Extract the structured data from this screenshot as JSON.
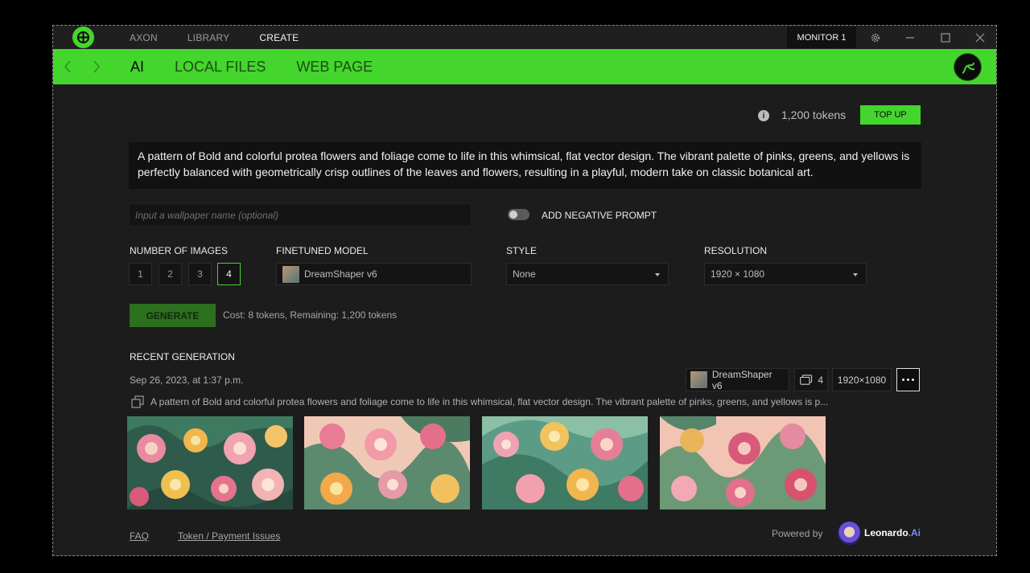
{
  "topnav": {
    "items": [
      "AXON",
      "LIBRARY",
      "CREATE"
    ],
    "active_index": 2
  },
  "titlebar": {
    "monitor_label": "MONITOR 1"
  },
  "subtabs": {
    "items": [
      "AI",
      "LOCAL FILES",
      "WEB PAGE"
    ],
    "active_index": 0
  },
  "tokens": {
    "count": "1,200 tokens",
    "topup_label": "TOP UP"
  },
  "prompt": "A pattern of Bold and colorful protea flowers and foliage come to life in this whimsical, flat vector design. The vibrant palette of pinks, greens, and yellows is perfectly balanced with geometrically crisp outlines of the leaves and flowers, resulting in a playful, modern take on classic botanical art.",
  "wallpaper_name": {
    "value": "",
    "placeholder": "Input a wallpaper name (optional)"
  },
  "negative_prompt": {
    "label": "ADD NEGATIVE PROMPT",
    "enabled": false
  },
  "number_of_images": {
    "label": "NUMBER OF IMAGES",
    "options": [
      "1",
      "2",
      "3",
      "4"
    ],
    "selected": "4"
  },
  "finetuned_model": {
    "label": "FINETUNED MODEL",
    "value": "DreamShaper v6"
  },
  "style": {
    "label": "STYLE",
    "value": "None"
  },
  "resolution": {
    "label": "RESOLUTION",
    "value": "1920 × 1080"
  },
  "generate": {
    "label": "GENERATE",
    "cost": "Cost: 8 tokens, Remaining: 1,200 tokens"
  },
  "recent": {
    "title": "RECENT GENERATION",
    "date": "Sep 26, 2023, at 1:37 p.m.",
    "model": "DreamShaper v6",
    "image_count": "4",
    "resolution": "1920×1080",
    "prompt": "A pattern of Bold and colorful protea flowers and foliage come to life in this whimsical, flat vector design. The vibrant palette of pinks, greens, and yellows is p..."
  },
  "footer": {
    "faq": "FAQ",
    "token_issues": "Token / Payment Issues",
    "powered_by": "Powered by",
    "brand": "Leonardo",
    "brand_suffix": ".Ai"
  },
  "colors": {
    "accent": "#44d62c",
    "background": "#1c1c1c",
    "titlebar": "#1f1f1f"
  }
}
